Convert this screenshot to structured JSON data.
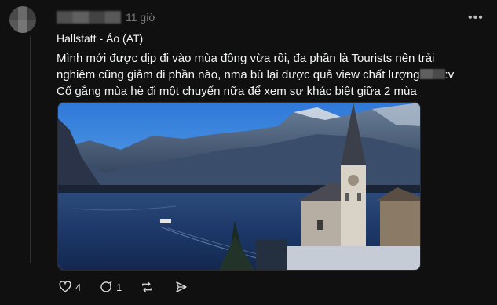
{
  "post": {
    "time": "11 giờ",
    "more_icon": "more-dots-icon",
    "topic": "Hallstatt - Áo (AT)",
    "body_part1": "Mình mới được dịp đi vào mùa đông vừa rồi, đa phần là Tourists nên trải nghiệm cũng giảm đi phần nào, nma bù lại được quả view chất lượng",
    "body_part2": ":v Cố gắng mùa hè đi một chuyến nữa để xem sự khác biệt giữa 2 mùa"
  },
  "actions": {
    "like_count": "4",
    "comment_count": "1",
    "icons": [
      "heart-icon",
      "comment-icon",
      "repost-icon",
      "share-icon"
    ]
  }
}
